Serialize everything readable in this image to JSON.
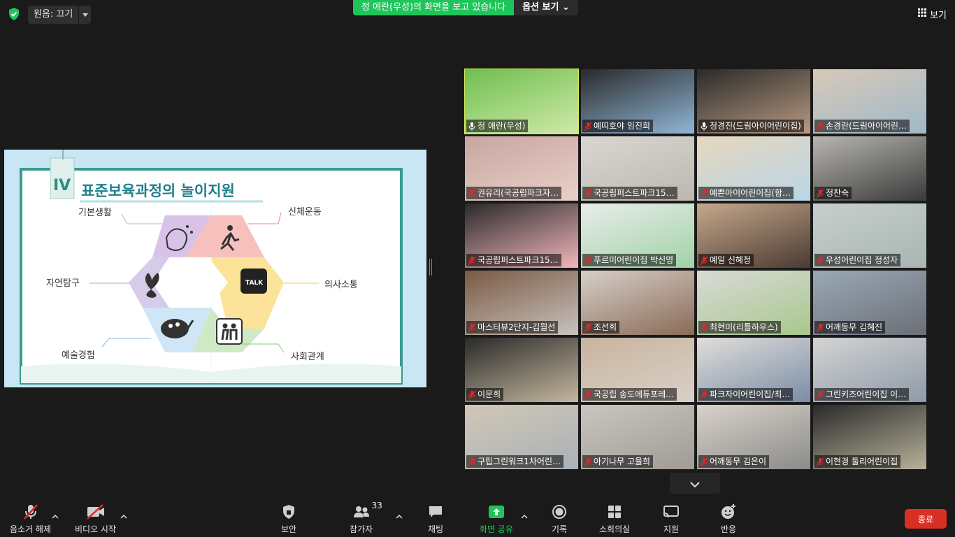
{
  "topbar": {
    "audio_label": "원음: 끄기",
    "share_message": "정 애란(우성)의 화면을 보고 있습니다",
    "options_label": "옵션 보기",
    "view_label": "보기"
  },
  "slide": {
    "numeral": "IV",
    "title": "표준보육과정의 놀이지원",
    "areas": {
      "basic_life": "기본생활",
      "physical": "신체운동",
      "communication": "의사소통",
      "social": "사회관계",
      "art": "예술경험",
      "nature": "자연탐구"
    },
    "talk_icon_text": "TALK"
  },
  "participants": [
    {
      "name": "정 애란(우성)",
      "muted": false,
      "active": true
    },
    {
      "name": "예띠호야 임진희",
      "muted": true
    },
    {
      "name": "정경진(드림아이어린이집)",
      "muted": false
    },
    {
      "name": "손경란(드림아이어린…",
      "muted": true
    },
    {
      "name": "권유리(국공립파크자…",
      "muted": true
    },
    {
      "name": "국공립퍼스트파크15…",
      "muted": true
    },
    {
      "name": "예쁜아이어린이집(함…",
      "muted": true
    },
    {
      "name": "정찬숙",
      "muted": true
    },
    {
      "name": "국공립퍼스트파크15…",
      "muted": true
    },
    {
      "name": "푸르미어린이집 박신영",
      "muted": true
    },
    {
      "name": "예일 신혜정",
      "muted": true
    },
    {
      "name": "우성어린이집 정성자",
      "muted": true
    },
    {
      "name": "마스터뷰2단지-김월선",
      "muted": true
    },
    {
      "name": "조선희",
      "muted": true
    },
    {
      "name": "최현미(리틀하우스)",
      "muted": true
    },
    {
      "name": "어깨동무 김혜진",
      "muted": true
    },
    {
      "name": "이문희",
      "muted": true
    },
    {
      "name": "국공립 송도에듀포레…",
      "muted": true
    },
    {
      "name": "파크자이어린이집/최…",
      "muted": true
    },
    {
      "name": "그린키즈어린이집 이…",
      "muted": true
    },
    {
      "name": "구립그린워크1차어린…",
      "muted": true
    },
    {
      "name": "아기나무 고율희",
      "muted": true
    },
    {
      "name": "어깨동무 김은이",
      "muted": true
    },
    {
      "name": "이현경 둘리어린이집",
      "muted": true
    }
  ],
  "toolbar": {
    "unmute": "음소거 해제",
    "start_video": "비디오 시작",
    "security": "보안",
    "participants": "참가자",
    "participant_count": "33",
    "chat": "채팅",
    "share_screen": "화면 공유",
    "record": "기록",
    "breakout": "소회의실",
    "support": "지원",
    "reactions": "반응",
    "end": "종료"
  },
  "colors": {
    "share_green": "#1fc55a",
    "end_red": "#d93025",
    "active_outline": "#d7ec5a",
    "mute_red": "#e02828"
  }
}
